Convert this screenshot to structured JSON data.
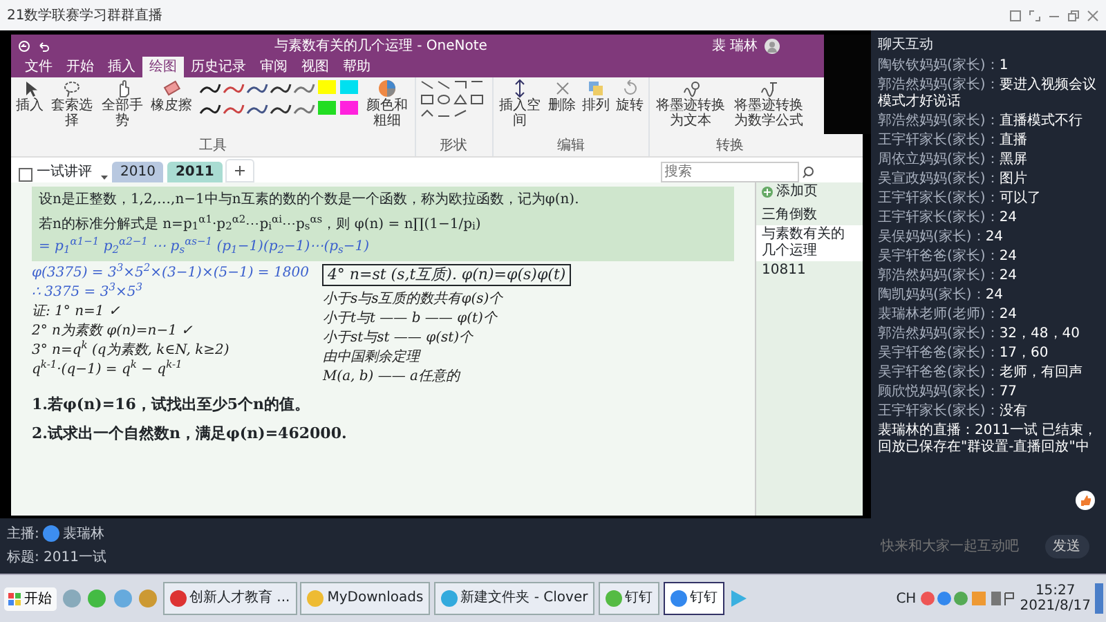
{
  "app_title": "21数学联赛学习群群直播",
  "onenote": {
    "window_title": "与素数有关的几个运理 - OneNote",
    "user": "裴 瑞林",
    "menu": [
      {
        "label": "文件",
        "selected": false
      },
      {
        "label": "开始",
        "selected": false
      },
      {
        "label": "插入",
        "selected": false
      },
      {
        "label": "绘图",
        "selected": true
      },
      {
        "label": "历史记录",
        "selected": false
      },
      {
        "label": "审阅",
        "selected": false
      },
      {
        "label": "视图",
        "selected": false
      },
      {
        "label": "帮助",
        "selected": false
      }
    ],
    "tools": [
      "插入",
      "套索选择",
      "全部手势",
      "橡皮擦"
    ],
    "color_button": "颜色和粗细",
    "edit_tools": [
      "插入空间",
      "删除",
      "排列",
      "旋转"
    ],
    "convert_tools": [
      "将墨迹转换为文本",
      "将墨迹转换为数学公式"
    ],
    "groups": [
      "工具",
      "形状",
      "编辑",
      "转换"
    ],
    "notebook": "一试讲评",
    "section_tabs": [
      {
        "label": "2010",
        "selected": false
      },
      {
        "label": "2011",
        "selected": true
      }
    ],
    "search_placeholder": "搜索",
    "printed": [
      "设n是正整数，1,2,…,n−1中与n互素的数的个数是一个函数，称为欧拉函数，记为φ(n).",
      "若n的标准分解式是 n=p$_{1}$$^{α1}$·p$_{2}$$^{α2}$⋯p$_{i}$$^{αi}$⋯p$_{s}$$^{αs}$，则 φ(n) = n∏(1−1/p$_{i}$)"
    ],
    "formula_note": "= p$_{1}$$^{α1−1}$ p$_{2}$$^{α2−1}$ ⋯ p$_{s}$$^{αs−1}$ (p$_{1}$−1)(p$_{2}$−1)⋯(p$_{s}$−1)",
    "handwriting_left": [
      {
        "text": "φ(3375) = 3$^{3}$×5$^{2}$×(3−1)×(5−1) = 1800",
        "color": "#3a5fcd"
      },
      {
        "text": "∴ 3375 = 3$^{3}$×5$^{3}$",
        "color": "#3a5fcd"
      },
      {
        "text": "证: 1° n=1 ✓",
        "color": "#222222"
      },
      {
        "text": "2° n为素数  φ(n)=n−1 ✓",
        "color": "#222222"
      },
      {
        "text": "3° n=q$^{k}$ (q为素数, k∈N, k≥2)",
        "color": "#222222"
      },
      {
        "text": "q$^{k-1}$·(q−1) = q$^{k}$ − q$^{k-1}$",
        "color": "#222222"
      }
    ],
    "handwriting_right": [
      {
        "text": "小于s与s互质的数共有φ(s)个",
        "color": "#222222"
      },
      {
        "text": "小于t与t —— b —— φ(t)个",
        "color": "#222222"
      },
      {
        "text": "小于st与st —— φ(st)个",
        "color": "#222222"
      },
      {
        "text": "由中国剩余定理",
        "color": "#222222"
      },
      {
        "text": "M(a, b) —— a任意的",
        "color": "#222222"
      }
    ],
    "boxed_note": "4° n=st (s,t互质). φ(n)=φ(s)φ(t)",
    "problems": [
      "1.若φ(n)=16，试找出至少5个n的值。",
      "2.试求出一个自然数n，满足φ(n)=462000."
    ],
    "add_page": "添加页",
    "pages": [
      {
        "label": "三角倒数",
        "selected": false
      },
      {
        "label": "与素数有关的几个运理",
        "selected": true
      },
      {
        "label": "10811",
        "selected": false
      }
    ]
  },
  "chat": {
    "title": "聊天互动",
    "messages": [
      {
        "user": "陶钦钦妈妈(家长)：",
        "text": "1",
        "kind": "user"
      },
      {
        "user": "郭浩然妈妈(家长)：",
        "text": "要进入视频会议模式才好说话",
        "kind": "user"
      },
      {
        "user": "郭浩然妈妈(家长)：",
        "text": "直播模式不行",
        "kind": "user"
      },
      {
        "user": "王宇轩家长(家长)：",
        "text": "直播",
        "kind": "user"
      },
      {
        "user": "周依立妈妈(家长)：",
        "text": "黑屏",
        "kind": "user"
      },
      {
        "user": "吴宣政妈妈(家长)：",
        "text": "图片",
        "kind": "user"
      },
      {
        "user": "王宇轩家长(家长)：",
        "text": "可以了",
        "kind": "user"
      },
      {
        "user": "王宇轩家长(家长)：",
        "text": "24",
        "kind": "user"
      },
      {
        "user": "吴俣妈妈(家长)：",
        "text": "24",
        "kind": "user"
      },
      {
        "user": "吴宇轩爸爸(家长)：",
        "text": "24",
        "kind": "user"
      },
      {
        "user": "郭浩然妈妈(家长)：",
        "text": "24",
        "kind": "user"
      },
      {
        "user": "陶凯妈妈(家长)：",
        "text": "24",
        "kind": "user"
      },
      {
        "user": "裴瑞林老师(老师)：",
        "text": "24",
        "kind": "user"
      },
      {
        "user": "郭浩然妈妈(家长)：",
        "text": "32，48，40",
        "kind": "user"
      },
      {
        "user": "吴宇轩爸爸(家长)：",
        "text": "17，60",
        "kind": "user"
      },
      {
        "user": "吴宇轩爸爸(家长)：",
        "text": "老师，有回声",
        "kind": "user"
      },
      {
        "user": "顾欣悦妈妈(家长)：",
        "text": "77",
        "kind": "user"
      },
      {
        "user": "王宇轩家长(家长)：",
        "text": "没有",
        "kind": "user"
      },
      {
        "user": "裴瑞林的直播：",
        "text": "2011一试 已结束，回放已保存在\"群设置-直播回放\"中",
        "kind": "system"
      }
    ],
    "input_placeholder": "快来和大家一起互动吧",
    "send": "发送"
  },
  "host": {
    "label": "主播:",
    "name": "裴瑞林"
  },
  "topic": "标题: 2011一试",
  "taskbar": {
    "start": "开始",
    "items": [
      {
        "label": "创新人才教育 ...",
        "selected": false
      },
      {
        "label": "MyDownloads",
        "selected": false
      },
      {
        "label": "新建文件夹 - Clover",
        "selected": false
      },
      {
        "label": "钉钉",
        "selected": false
      },
      {
        "label": "钉钉",
        "selected": true
      }
    ],
    "lang": "CH",
    "time": "15:27",
    "date": "2021/8/17"
  }
}
